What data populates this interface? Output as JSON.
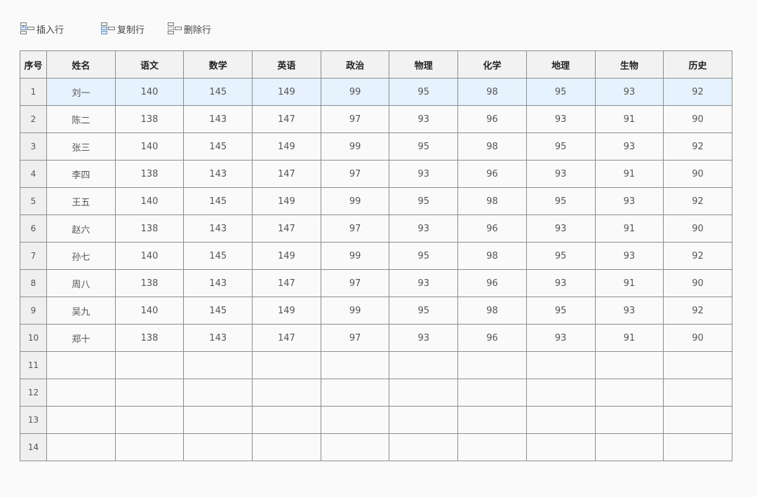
{
  "toolbar": {
    "insert_label": "插入行",
    "copy_label": "复制行",
    "delete_label": "删除行"
  },
  "colors": {
    "selected_row_bg": "#e6f2fd",
    "border": "#8c8c8c",
    "header_bg": "#f2f2f2"
  },
  "table": {
    "columns": [
      "序号",
      "姓名",
      "语文",
      "数学",
      "英语",
      "政治",
      "物理",
      "化学",
      "地理",
      "生物",
      "历史"
    ],
    "selected_row": 0,
    "rows": [
      [
        "1",
        "刘一",
        "140",
        "145",
        "149",
        "99",
        "95",
        "98",
        "95",
        "93",
        "92"
      ],
      [
        "2",
        "陈二",
        "138",
        "143",
        "147",
        "97",
        "93",
        "96",
        "93",
        "91",
        "90"
      ],
      [
        "3",
        "张三",
        "140",
        "145",
        "149",
        "99",
        "95",
        "98",
        "95",
        "93",
        "92"
      ],
      [
        "4",
        "李四",
        "138",
        "143",
        "147",
        "97",
        "93",
        "96",
        "93",
        "91",
        "90"
      ],
      [
        "5",
        "王五",
        "140",
        "145",
        "149",
        "99",
        "95",
        "98",
        "95",
        "93",
        "92"
      ],
      [
        "6",
        "赵六",
        "138",
        "143",
        "147",
        "97",
        "93",
        "96",
        "93",
        "91",
        "90"
      ],
      [
        "7",
        "孙七",
        "140",
        "145",
        "149",
        "99",
        "95",
        "98",
        "95",
        "93",
        "92"
      ],
      [
        "8",
        "周八",
        "138",
        "143",
        "147",
        "97",
        "93",
        "96",
        "93",
        "91",
        "90"
      ],
      [
        "9",
        "吴九",
        "140",
        "145",
        "149",
        "99",
        "95",
        "98",
        "95",
        "93",
        "92"
      ],
      [
        "10",
        "郑十",
        "138",
        "143",
        "147",
        "97",
        "93",
        "96",
        "93",
        "91",
        "90"
      ],
      [
        "11",
        "",
        "",
        "",
        "",
        "",
        "",
        "",
        "",
        "",
        ""
      ],
      [
        "12",
        "",
        "",
        "",
        "",
        "",
        "",
        "",
        "",
        "",
        ""
      ],
      [
        "13",
        "",
        "",
        "",
        "",
        "",
        "",
        "",
        "",
        "",
        ""
      ],
      [
        "14",
        "",
        "",
        "",
        "",
        "",
        "",
        "",
        "",
        "",
        ""
      ]
    ]
  }
}
